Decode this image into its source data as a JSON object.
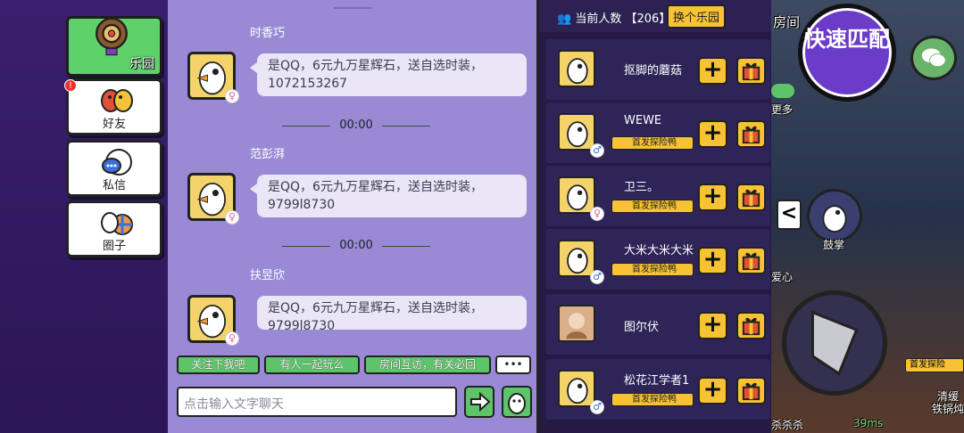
{
  "nav": {
    "park": "乐园",
    "friends": "好友",
    "messages": "私信",
    "circle": "圈子",
    "alert_mark": "!"
  },
  "chat": {
    "top_time": "",
    "messages": [
      {
        "sender": "时香巧",
        "text": "是QQ，6元九万星辉石，送自选时装，1072153267",
        "gender": "♀"
      },
      {
        "sender": "范彭湃",
        "text": "是QQ，6元九万星辉石，送自选时装，9799l8730",
        "gender": "♀"
      },
      {
        "sender": "扶昱欣",
        "text": "是QQ，6元九万星辉石，送自选时装，9799l8730",
        "gender": "♀"
      }
    ],
    "separators": [
      "00:00",
      "00:00"
    ],
    "quick_phrases": [
      "关注下我吧",
      "有人一起玩么",
      "房间互访，有关必回"
    ],
    "more_label": "•••",
    "input_placeholder": "点击输入文字聊天"
  },
  "userlist": {
    "online_label": "当前人数",
    "online_count": "206",
    "swap_label": "换个乐园",
    "users": [
      {
        "name": "抠脚的蘑菇",
        "badge": "",
        "gender": ""
      },
      {
        "name": "WEWE",
        "badge": "首发探险鸭",
        "gender": "♂"
      },
      {
        "name": "卫三。",
        "badge": "首发探险鸭",
        "gender": "♀"
      },
      {
        "name": "大米大米大米",
        "badge": "首发探险鸭",
        "gender": "♂"
      },
      {
        "name": "图尔伏",
        "badge": "",
        "gender": ""
      },
      {
        "name": "松花江学者1",
        "badge": "首发探险鸭",
        "gender": "♂"
      }
    ]
  },
  "game": {
    "quick_match": "快速匹配",
    "room": "房间",
    "more": "更多",
    "cheer": "鼓掌",
    "love": "爱心",
    "badge": "首发探险",
    "status": "杀杀杀",
    "ping": "39ms",
    "clean": "清缓",
    "pot": "铁锅炖"
  },
  "colors": {
    "accent_green": "#5ec46a",
    "accent_yellow": "#f7c233",
    "purple": "#6b3cc9"
  }
}
